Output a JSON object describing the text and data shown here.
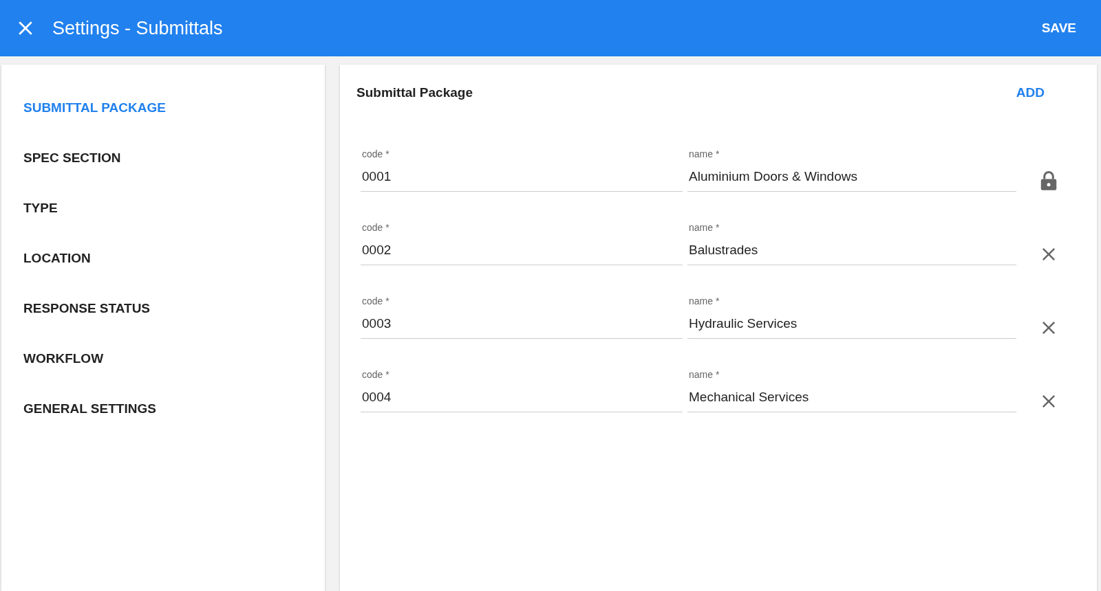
{
  "app_bar": {
    "title": "Settings - Submittals",
    "action": "SAVE"
  },
  "sidebar": {
    "items": [
      {
        "label": "SUBMITTAL PACKAGE",
        "selected": true
      },
      {
        "label": "SPEC SECTION",
        "selected": false
      },
      {
        "label": "TYPE",
        "selected": false
      },
      {
        "label": "LOCATION",
        "selected": false
      },
      {
        "label": "RESPONSE STATUS",
        "selected": false
      },
      {
        "label": "WORKFLOW",
        "selected": false
      },
      {
        "label": "GENERAL SETTINGS",
        "selected": false
      }
    ]
  },
  "panel": {
    "title": "Submittal Package",
    "action": "ADD",
    "rows": [
      {
        "code_label": "code *",
        "code": "0001",
        "name_label": "name *",
        "name": "Aluminium Doors & Windows",
        "kind": "locked"
      },
      {
        "code_label": "code *",
        "code": "0002",
        "name_label": "name *",
        "name": "Balustrades",
        "kind": "removable"
      },
      {
        "code_label": "code *",
        "code": "0003",
        "name_label": "name *",
        "name": "Hydraulic Services",
        "kind": "removable"
      },
      {
        "code_label": "code *",
        "code": "0004",
        "name_label": "name *",
        "name": "Mechanical Services",
        "kind": "removable"
      }
    ]
  }
}
